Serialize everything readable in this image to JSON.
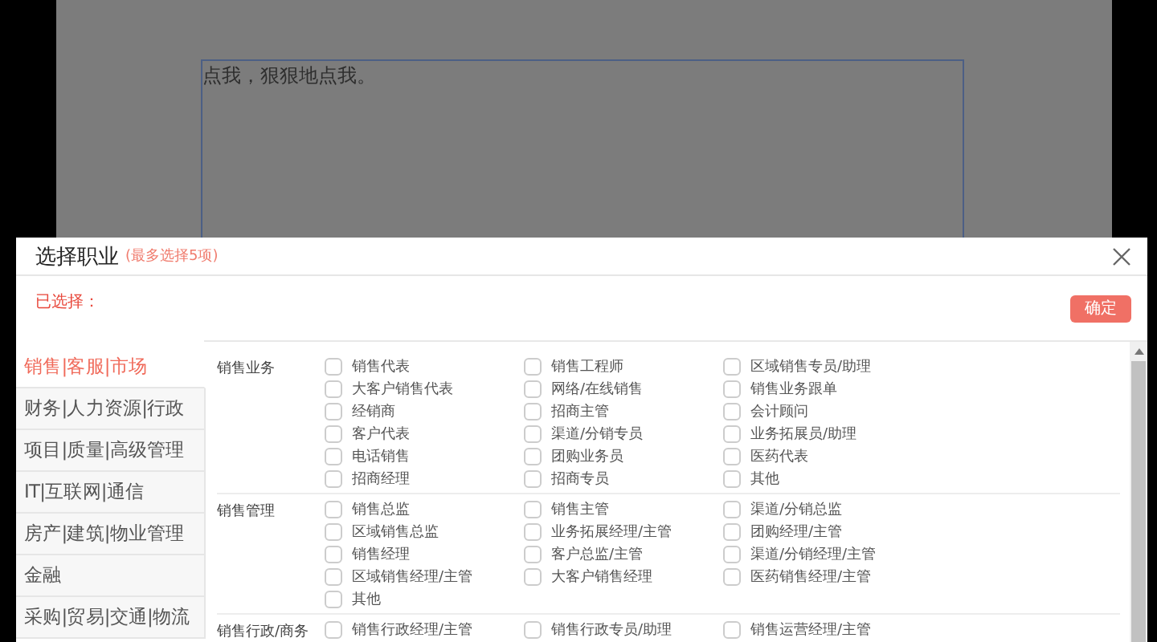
{
  "page": {
    "textarea_text": "点我，狠狠地点我。"
  },
  "dialog": {
    "title": "选择职业",
    "hint": "(最多选择5项)",
    "selected_label": "已选择：",
    "confirm_button": "确定"
  },
  "categories": [
    {
      "label": "销售|客服|市场",
      "selected": true
    },
    {
      "label": "财务|人力资源|行政",
      "selected": false
    },
    {
      "label": "项目|质量|高级管理",
      "selected": false
    },
    {
      "label": "IT|互联网|通信",
      "selected": false
    },
    {
      "label": "房产|建筑|物业管理",
      "selected": false
    },
    {
      "label": "金融",
      "selected": false
    },
    {
      "label": "采购|贸易|交通|物流",
      "selected": false
    }
  ],
  "groups": [
    {
      "name": "销售业务",
      "items": [
        {
          "label": "销售代表",
          "checked": false
        },
        {
          "label": "销售工程师",
          "checked": false
        },
        {
          "label": "区域销售专员/助理",
          "checked": false
        },
        {
          "label": "大客户销售代表",
          "checked": false
        },
        {
          "label": "网络/在线销售",
          "checked": false
        },
        {
          "label": "销售业务跟单",
          "checked": false
        },
        {
          "label": "经销商",
          "checked": false
        },
        {
          "label": "招商主管",
          "checked": false
        },
        {
          "label": "会计顾问",
          "checked": false
        },
        {
          "label": "客户代表",
          "checked": false
        },
        {
          "label": "渠道/分销专员",
          "checked": false
        },
        {
          "label": "业务拓展员/助理",
          "checked": false
        },
        {
          "label": "电话销售",
          "checked": false
        },
        {
          "label": "团购业务员",
          "checked": false
        },
        {
          "label": "医药代表",
          "checked": false
        },
        {
          "label": "招商经理",
          "checked": false
        },
        {
          "label": "招商专员",
          "checked": false
        },
        {
          "label": "其他",
          "checked": false
        }
      ]
    },
    {
      "name": "销售管理",
      "items": [
        {
          "label": "销售总监",
          "checked": false
        },
        {
          "label": "销售主管",
          "checked": false
        },
        {
          "label": "渠道/分销总监",
          "checked": false
        },
        {
          "label": "区域销售总监",
          "checked": false
        },
        {
          "label": "业务拓展经理/主管",
          "checked": false
        },
        {
          "label": "团购经理/主管",
          "checked": false
        },
        {
          "label": "销售经理",
          "checked": false
        },
        {
          "label": "客户总监/主管",
          "checked": false
        },
        {
          "label": "渠道/分销经理/主管",
          "checked": false
        },
        {
          "label": "区域销售经理/主管",
          "checked": false
        },
        {
          "label": "大客户销售经理",
          "checked": false
        },
        {
          "label": "医药销售经理/主管",
          "checked": false
        },
        {
          "label": "其他",
          "checked": false
        }
      ]
    },
    {
      "name": "销售行政/商务",
      "items": [
        {
          "label": "销售行政经理/主管",
          "checked": false
        },
        {
          "label": "销售行政专员/助理",
          "checked": false
        },
        {
          "label": "销售运营经理/主管",
          "checked": false
        }
      ]
    }
  ]
}
